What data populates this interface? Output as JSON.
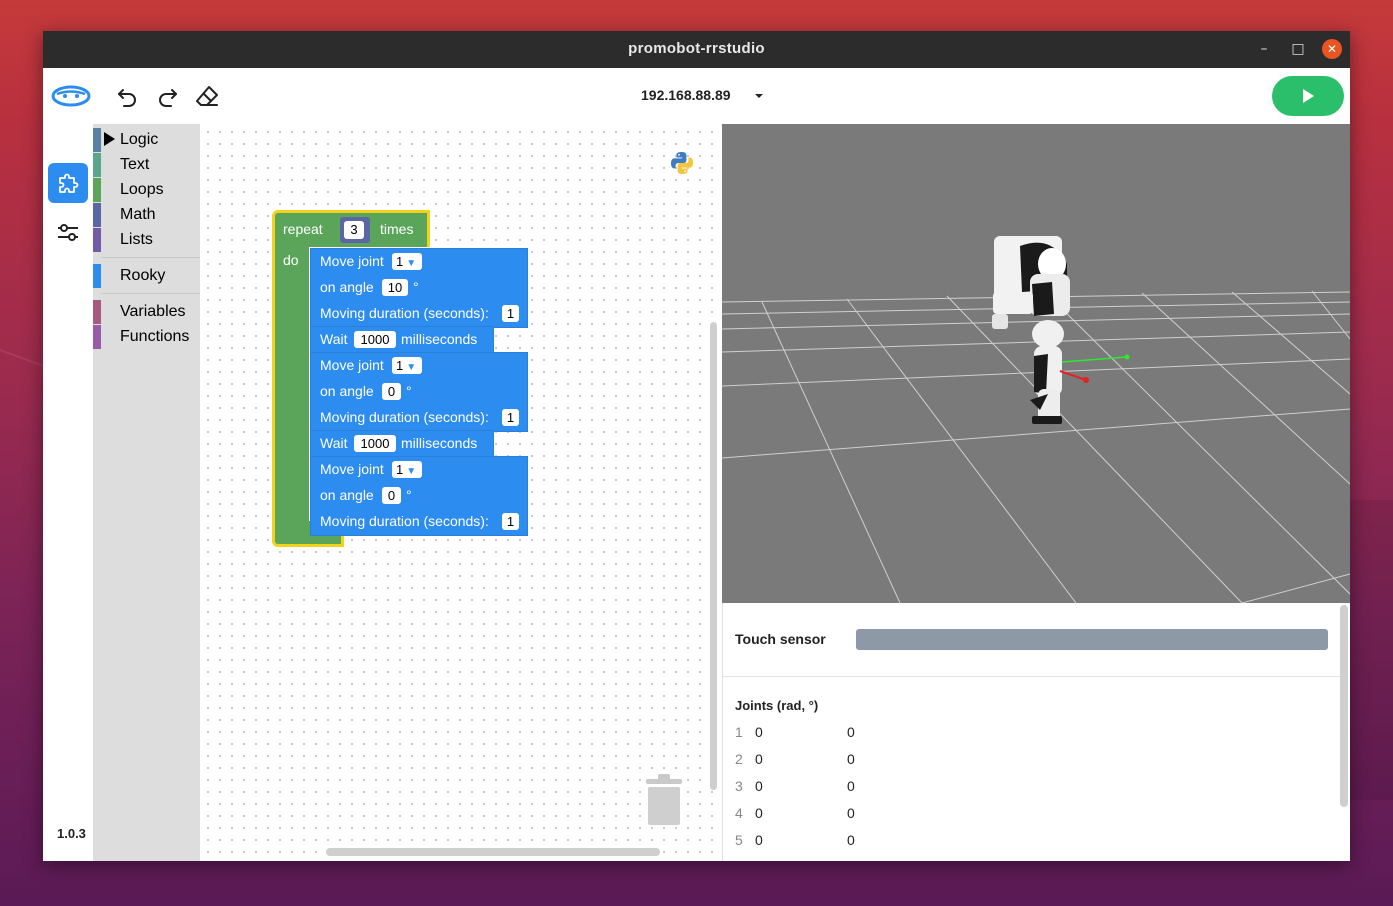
{
  "window": {
    "title": "promobot-rrstudio"
  },
  "toolbar": {
    "ip_address": "192.168.88.89",
    "icons": [
      "logo-icon",
      "undo-icon",
      "redo-icon",
      "eraser-icon",
      "chevron-down-icon",
      "play-icon"
    ]
  },
  "left_rail": {
    "version": "1.0.3",
    "icons": [
      "puzzle-icon",
      "sliders-icon"
    ]
  },
  "toolbox": {
    "categories": [
      {
        "label": "Logic",
        "color": "#5b80a5"
      },
      {
        "label": "Text",
        "color": "#5ba58c"
      },
      {
        "label": "Loops",
        "color": "#5ba55b"
      },
      {
        "label": "Math",
        "color": "#5b67a5"
      },
      {
        "label": "Lists",
        "color": "#745ba5"
      },
      {
        "label": "Rooky",
        "color": "#2d8cf0"
      },
      {
        "label": "Variables",
        "color": "#a55b80"
      },
      {
        "label": "Functions",
        "color": "#995ba5"
      }
    ]
  },
  "workspace": {
    "repeat_block": {
      "repeat_label": "repeat",
      "count": "3",
      "times_label": "times",
      "do_label": "do"
    },
    "blocks": [
      {
        "type": "move",
        "label": "Move joint",
        "joint": "1",
        "angle_label": "on angle",
        "angle": "10",
        "deg": "°",
        "duration_label": "Moving duration (seconds):",
        "duration": "1"
      },
      {
        "type": "wait",
        "label": "Wait",
        "ms": "1000",
        "unit": "milliseconds"
      },
      {
        "type": "move",
        "label": "Move joint",
        "joint": "1",
        "angle_label": "on angle",
        "angle": "0",
        "deg": "°",
        "duration_label": "Moving duration (seconds):",
        "duration": "1"
      },
      {
        "type": "wait",
        "label": "Wait",
        "ms": "1000",
        "unit": "milliseconds"
      },
      {
        "type": "move",
        "label": "Move joint",
        "joint": "1",
        "angle_label": "on angle",
        "angle": "0",
        "deg": "°",
        "duration_label": "Moving duration (seconds):",
        "duration": "1"
      }
    ]
  },
  "panel": {
    "touch_sensor_label": "Touch sensor",
    "joints_title": "Joints (rad, °)",
    "joints": [
      {
        "index": "1",
        "rad": "0",
        "deg": "0"
      },
      {
        "index": "2",
        "rad": "0",
        "deg": "0"
      },
      {
        "index": "3",
        "rad": "0",
        "deg": "0"
      },
      {
        "index": "4",
        "rad": "0",
        "deg": "0"
      },
      {
        "index": "5",
        "rad": "0",
        "deg": "0"
      }
    ]
  },
  "colors": {
    "accent": "#2d8cf0",
    "run": "#2cbf6b",
    "loops": "#5ba55b",
    "highlight": "#f2d21b"
  }
}
